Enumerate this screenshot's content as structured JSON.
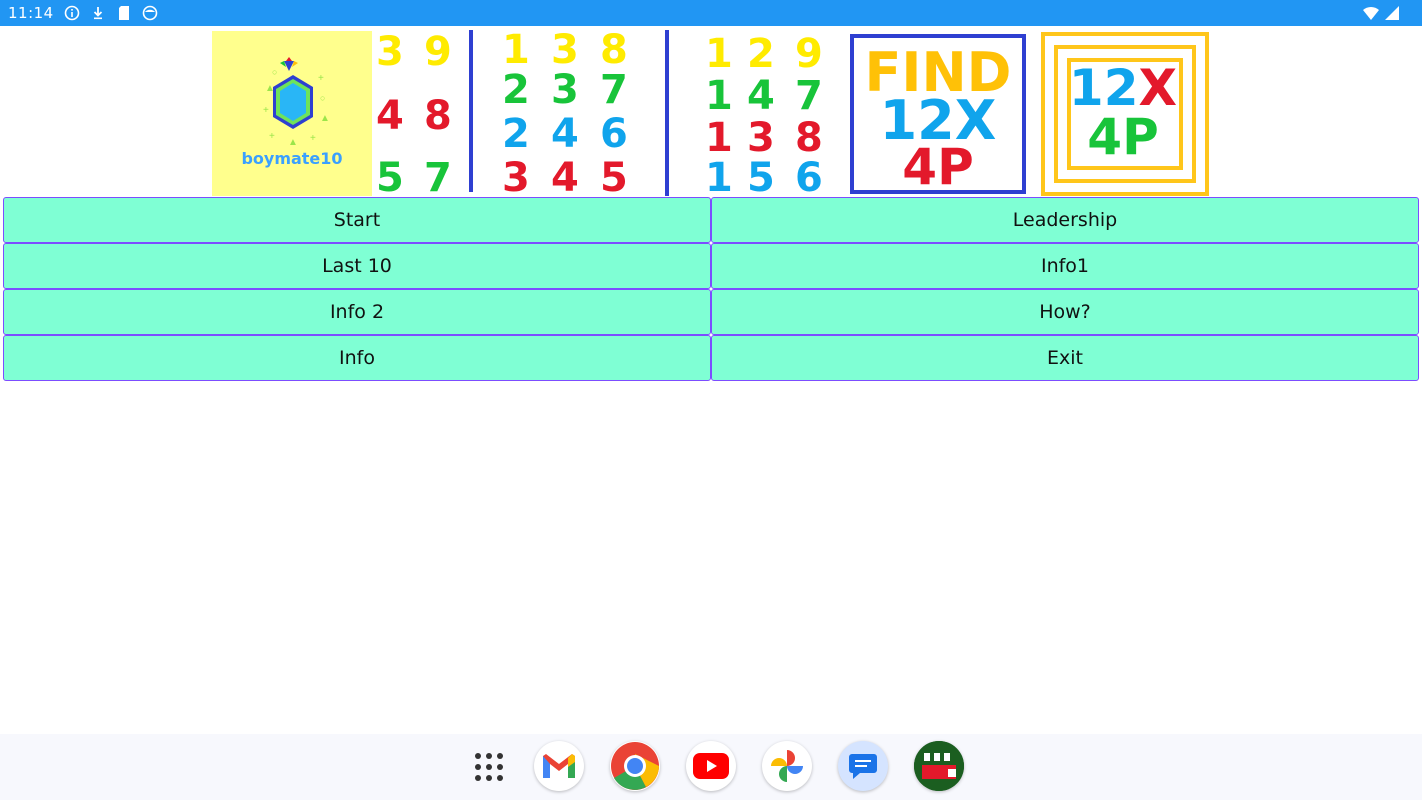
{
  "status_bar": {
    "time": "11:14"
  },
  "banner": {
    "logo_text": "boymate10",
    "group1": {
      "row1": [
        "3",
        "9"
      ],
      "row2": [
        "4",
        "8"
      ],
      "row3": [
        "5",
        "7"
      ]
    },
    "group2": {
      "row1": [
        "1",
        "3",
        "8"
      ],
      "row2": [
        "2",
        "3",
        "7"
      ],
      "row3": [
        "2",
        "4",
        "6"
      ],
      "row4": [
        "3",
        "4",
        "5"
      ]
    },
    "group3": {
      "row1": [
        "1",
        "2",
        "9"
      ],
      "row2": [
        "1",
        "4",
        "7"
      ],
      "row3": [
        "1",
        "3",
        "8"
      ],
      "row4": [
        "1",
        "5",
        "6"
      ]
    },
    "find_box": {
      "line1": "FIND",
      "line2": "12X",
      "line3": "4P"
    },
    "framed": {
      "line1a": "12",
      "line1b": "X",
      "line2": "4P"
    }
  },
  "menu": {
    "start": "Start",
    "leadership": "Leadership",
    "last10": "Last 10",
    "info1": "Info1",
    "info2": "Info 2",
    "how": "How?",
    "info": "Info",
    "exit": "Exit"
  },
  "dock": {
    "apps": [
      "apps-grid-icon",
      "gmail-icon",
      "chrome-icon",
      "youtube-icon",
      "photos-icon",
      "messages-icon",
      "find12x4p-icon"
    ]
  },
  "colors": {
    "status_bar": "#2196f3",
    "button_bg": "#7fffd4",
    "button_border": "#7c4dff",
    "logo_bg": "#ffff8d"
  }
}
